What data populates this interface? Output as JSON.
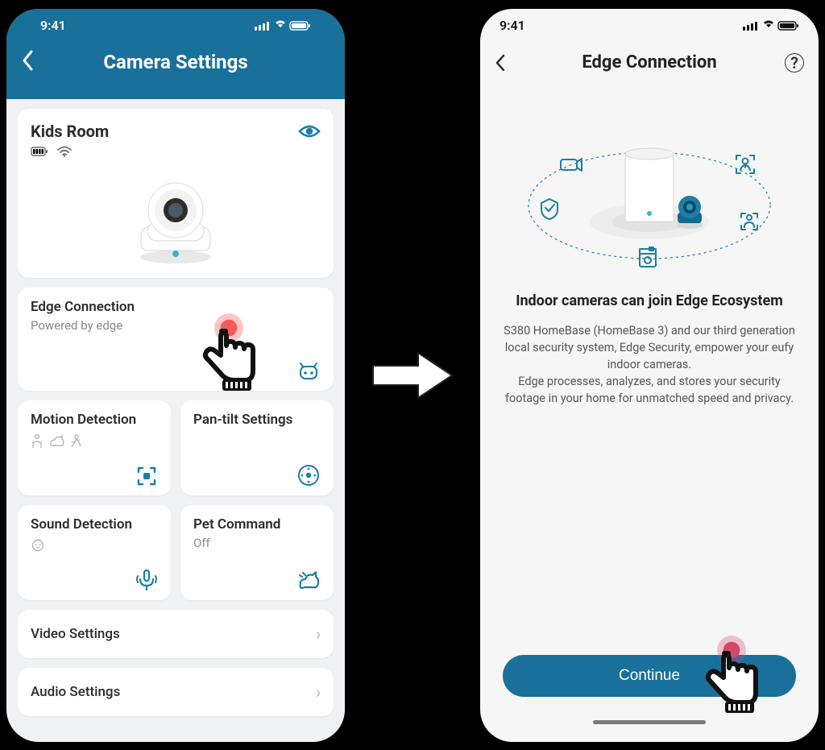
{
  "status_time": "9:41",
  "left": {
    "header_title": "Camera Settings",
    "device_name": "Kids Room",
    "tiles": {
      "edge": {
        "title": "Edge Connection",
        "sub": "Powered by edge"
      },
      "motion": {
        "title": "Motion Detection"
      },
      "pantilt": {
        "title": "Pan-tilt Settings"
      },
      "sound": {
        "title": "Sound Detection"
      },
      "pet": {
        "title": "Pet Command",
        "sub": "Off"
      }
    },
    "rows": {
      "video": "Video Settings",
      "audio": "Audio Settings"
    }
  },
  "right": {
    "header_title": "Edge Connection",
    "headline": "Indoor cameras can join Edge Ecosystem",
    "body": "S380 HomeBase (HomeBase 3) and our third generation local security system, Edge Security, empower your eufy indoor cameras.\nEdge processes, analyzes, and stores your security footage in your home for unmatched speed and privacy.",
    "continue": "Continue"
  }
}
